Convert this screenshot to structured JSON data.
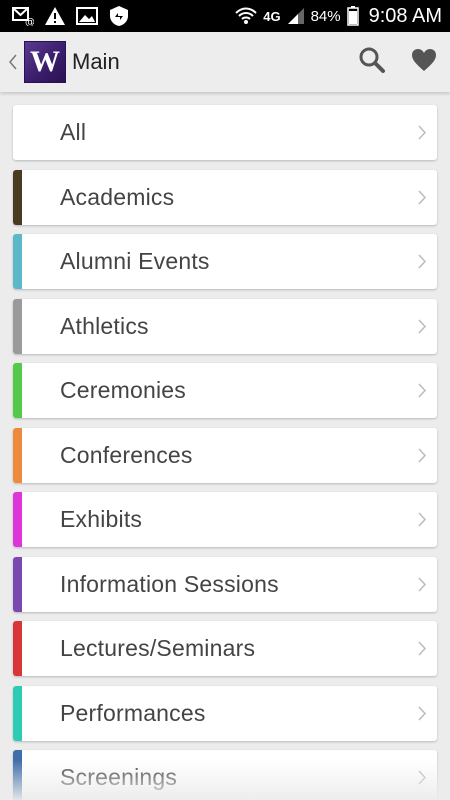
{
  "status_bar": {
    "network": "4G",
    "battery": "84%",
    "time": "9:08 AM",
    "icons": [
      "email-notification-icon",
      "warning-icon",
      "image-icon",
      "shield-sync-icon",
      "wifi-icon",
      "signal-icon",
      "battery-icon"
    ]
  },
  "action_bar": {
    "logo_letter": "W",
    "title": "Main",
    "icons": [
      "back-chevron-icon",
      "search-icon",
      "heart-icon"
    ]
  },
  "categories": [
    {
      "label": "All",
      "color": ""
    },
    {
      "label": "Academics",
      "color": "#4a3a1e"
    },
    {
      "label": "Alumni Events",
      "color": "#5bb8c9"
    },
    {
      "label": "Athletics",
      "color": "#9a9a9a"
    },
    {
      "label": "Ceremonies",
      "color": "#55c84a"
    },
    {
      "label": "Conferences",
      "color": "#ec8a3d"
    },
    {
      "label": "Exhibits",
      "color": "#dd35d9"
    },
    {
      "label": "Information Sessions",
      "color": "#7b48b1"
    },
    {
      "label": "Lectures/Seminars",
      "color": "#d9363a"
    },
    {
      "label": "Performances",
      "color": "#2dcbb4"
    },
    {
      "label": "Screenings",
      "color": "#3f6fa8"
    }
  ]
}
